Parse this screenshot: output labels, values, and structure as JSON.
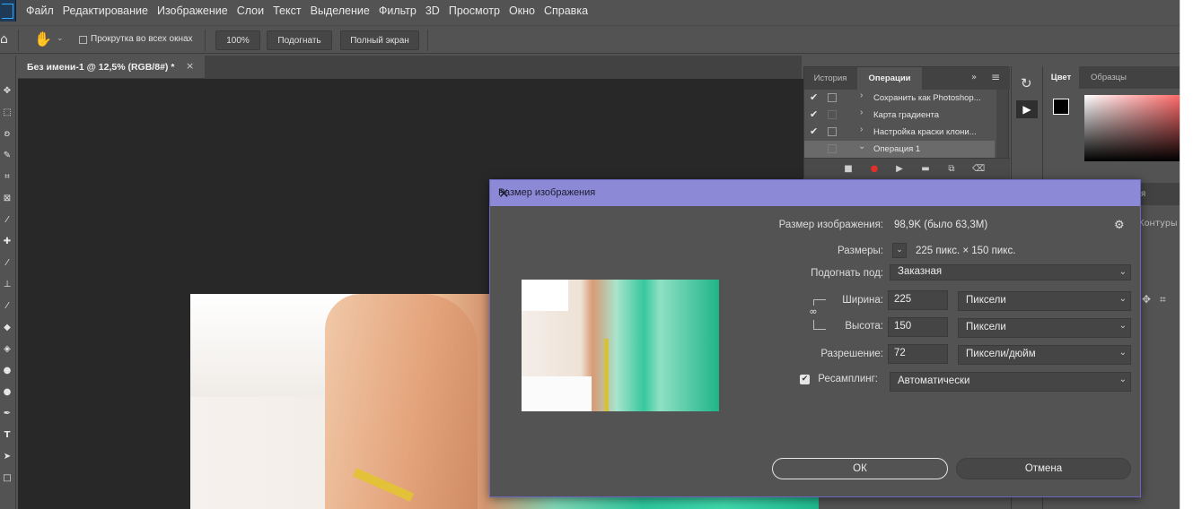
{
  "menubar": {
    "items": [
      "Файл",
      "Редактирование",
      "Изображение",
      "Слои",
      "Текст",
      "Выделение",
      "Фильтр",
      "3D",
      "Просмотр",
      "Окно",
      "Справка"
    ]
  },
  "options": {
    "scroll_all_label": "Прокрутка во всех окнах",
    "zoom_label": "100%",
    "fit_label": "Подогнать",
    "fullscreen_label": "Полный экран"
  },
  "document": {
    "tab_title": "Без имени-1 @ 12,5% (RGB/8#) *",
    "close_glyph": "×"
  },
  "panels": {
    "history_tab": "История",
    "actions_tab": "Операции",
    "actions": [
      {
        "checked": true,
        "label": "Сохранить как Photoshop..."
      },
      {
        "checked": true,
        "label": "Карта градиента"
      },
      {
        "checked": true,
        "label": "Настройка краски клони..."
      },
      {
        "checked": false,
        "label": "Операция 1"
      }
    ],
    "color_tab": "Цвет",
    "swatches_tab": "Образцы",
    "partial_tab": "ция",
    "paths_tab": "Контуры"
  },
  "dialog": {
    "title": "Размер изображения",
    "size_label": "Размер изображения:",
    "size_value": "98,9K (было 63,3M)",
    "dimensions_label": "Размеры:",
    "dimensions_value": "225 пикс.  ×  150 пикс.",
    "fit_label": "Подогнать под:",
    "fit_value": "Заказная",
    "width_label": "Ширина:",
    "width_value": "225",
    "width_unit": "Пиксели",
    "height_label": "Высота:",
    "height_value": "150",
    "height_unit": "Пиксели",
    "resolution_label": "Разрешение:",
    "resolution_value": "72",
    "resolution_unit": "Пиксели/дюйм",
    "resample_label": "Ресамплинг:",
    "resample_value": "Автоматически",
    "ok_label": "ОК",
    "cancel_label": "Отмена"
  },
  "colors": {
    "dialog_title_bg": "#8c8ad6",
    "panel_bg": "#535353",
    "canvas_bg": "#282828",
    "record_red": "#e0302a"
  }
}
